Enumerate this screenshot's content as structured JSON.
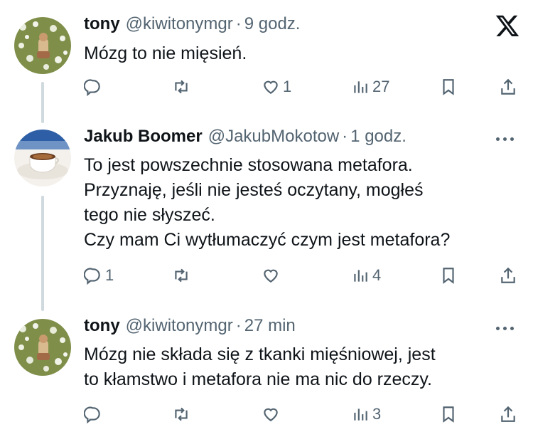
{
  "logo": {
    "icon": "x-logo-icon"
  },
  "tweets": [
    {
      "name": "tony",
      "handle": "@kiwitonymgr",
      "separator": "·",
      "time": "9 godz.",
      "lines": [
        "Mózg to nie mięsień."
      ],
      "reply_count": "",
      "like_count": "1",
      "view_count": "27"
    },
    {
      "name": "Jakub Boomer",
      "handle": "@JakubMokotow",
      "separator": "·",
      "time": "1 godz.",
      "lines": [
        "To jest powszechnie stosowana metafora.",
        "Przyznaję, jeśli nie jesteś oczytany, mogłeś",
        "tego nie słyszeć.",
        "Czy mam Ci wytłumaczyć czym jest metafora?"
      ],
      "reply_count": "1",
      "like_count": "",
      "view_count": "4"
    },
    {
      "name": "tony",
      "handle": "@kiwitonymgr",
      "separator": "·",
      "time": "27 min",
      "lines": [
        "Mózg nie składa się z tkanki mięśniowej, jest",
        "to kłamstwo i metafora nie ma nic do rzeczy."
      ],
      "reply_count": "",
      "like_count": "",
      "view_count": "3"
    }
  ],
  "colors": {
    "text": "#0f1419",
    "secondary": "#536471",
    "thread_line": "#cfd9de"
  }
}
